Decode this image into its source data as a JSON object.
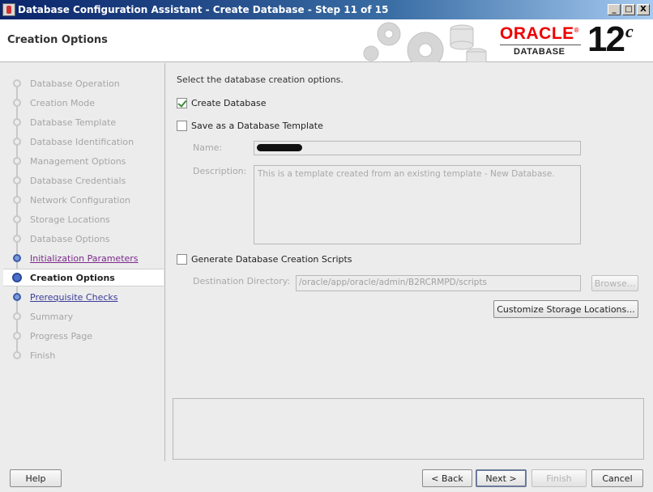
{
  "window": {
    "title": "Database Configuration Assistant - Create Database - Step 11 of 15",
    "minimize": "_",
    "maximize": "□",
    "close": "X"
  },
  "header": {
    "page_title": "Creation Options",
    "brand_name": "ORACLE",
    "brand_registered": "®",
    "brand_product": "DATABASE",
    "version": "12",
    "version_suffix": "c"
  },
  "nav": {
    "items": [
      {
        "label": "Database Operation",
        "state": "done"
      },
      {
        "label": "Creation Mode",
        "state": "done"
      },
      {
        "label": "Database Template",
        "state": "done"
      },
      {
        "label": "Database Identification",
        "state": "done"
      },
      {
        "label": "Management Options",
        "state": "done"
      },
      {
        "label": "Database Credentials",
        "state": "done"
      },
      {
        "label": "Network Configuration",
        "state": "done"
      },
      {
        "label": "Storage Locations",
        "state": "done"
      },
      {
        "label": "Database Options",
        "state": "done"
      },
      {
        "label": "Initialization Parameters",
        "state": "link-visited"
      },
      {
        "label": "Creation Options",
        "state": "current"
      },
      {
        "label": "Prerequisite Checks",
        "state": "link"
      },
      {
        "label": "Summary",
        "state": "pending"
      },
      {
        "label": "Progress Page",
        "state": "pending"
      },
      {
        "label": "Finish",
        "state": "pending"
      }
    ]
  },
  "main": {
    "intro": "Select the database creation options.",
    "create_database": {
      "label": "Create Database",
      "checked": true
    },
    "save_template": {
      "label": "Save as a Database Template",
      "checked": false
    },
    "name_label": "Name:",
    "name_value": "",
    "description_label": "Description:",
    "description_value": "This is a template created from an existing template - New Database.",
    "generate_scripts": {
      "label": "Generate Database Creation Scripts",
      "checked": false
    },
    "destination_label": "Destination Directory:",
    "destination_value": "/oracle/app/oracle/admin/B2RCRMPD/scripts",
    "browse_label": "Browse...",
    "customize_label": "Customize Storage Locations..."
  },
  "footer": {
    "help": "Help",
    "back": "< Back",
    "next": "Next >",
    "finish": "Finish",
    "cancel": "Cancel"
  },
  "colors": {
    "title_bar": "#0a246a",
    "oracle_red": "#e00000",
    "current_step": "#4a6fc8"
  }
}
